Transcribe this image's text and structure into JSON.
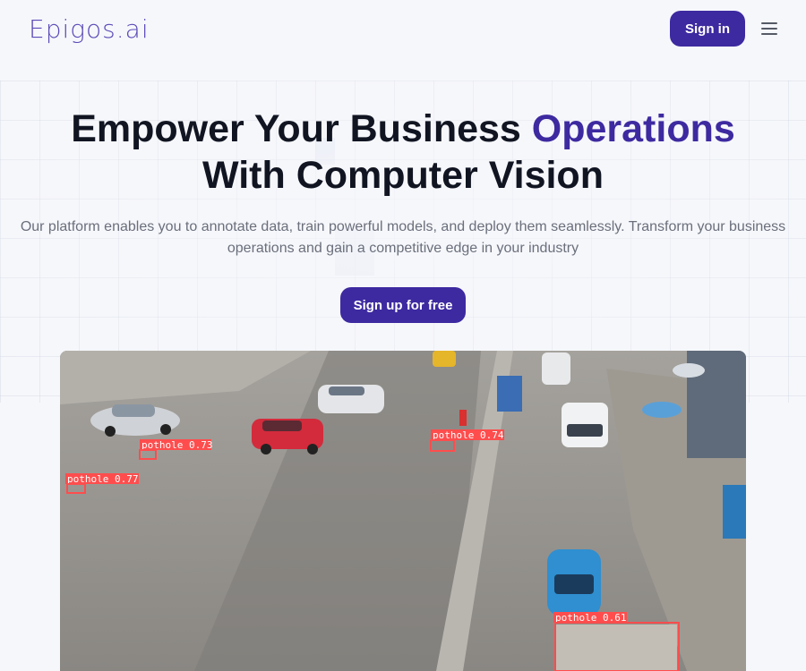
{
  "brand": {
    "logo_text": "Epigos.ai"
  },
  "nav": {
    "signin_label": "Sign in",
    "menu_icon": "hamburger-menu-icon"
  },
  "hero": {
    "title_part1": "Empower Your Business ",
    "title_accent": "Operations",
    "title_part2": "With Computer Vision",
    "subtitle": "Our platform enables you to annotate data, train powerful models, and deploy them seamlessly. Transform your business operations and gain a competitive edge in your industry",
    "cta_label": "Sign up for free"
  },
  "colors": {
    "accent": "#3d2aa0",
    "detection_box": "#ff4d4d"
  },
  "media": {
    "detections": [
      {
        "label": "pothole 0.73"
      },
      {
        "label": "pothole 0.74"
      },
      {
        "label": "pothole 0.77"
      },
      {
        "label": "pothole 0.61"
      }
    ]
  }
}
